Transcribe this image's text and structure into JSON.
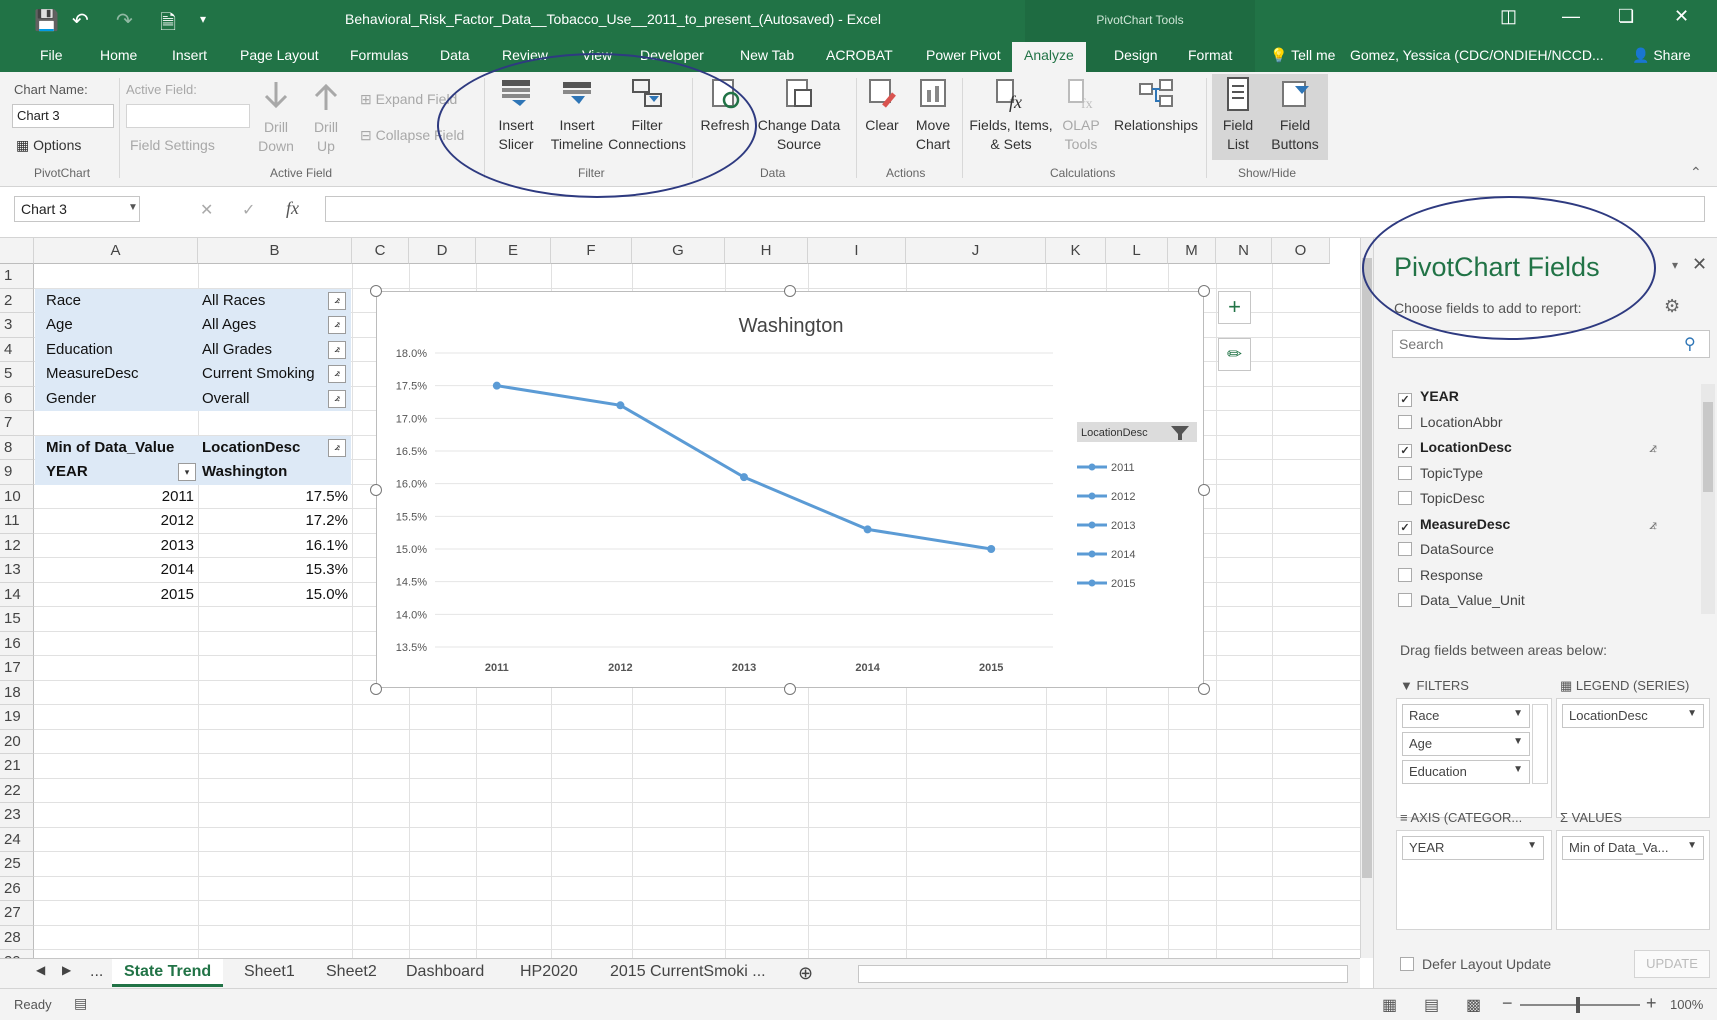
{
  "window": {
    "title": "Behavioral_Risk_Factor_Data__Tobacco_Use__2011_to_present_(Autosaved) - Excel",
    "context_header": "PivotChart Tools",
    "user": "Gomez, Yessica (CDC/ONDIEH/NCCD...",
    "share": "Share",
    "tell_me": "Tell me"
  },
  "tabs": [
    "File",
    "Home",
    "Insert",
    "Page Layout",
    "Formulas",
    "Data",
    "Review",
    "View",
    "Developer",
    "New Tab",
    "ACROBAT",
    "Power Pivot",
    "Analyze",
    "Design",
    "Format"
  ],
  "active_tab": "Analyze",
  "ribbon": {
    "chart_name_label": "Chart Name:",
    "chart_name_value": "Chart 3",
    "options": "Options",
    "group_pivotchart": "PivotChart",
    "active_field_label": "Active Field:",
    "field_settings": "Field Settings",
    "drill_down": "Drill Down",
    "drill_up": "Drill Up",
    "expand_field": "Expand Field",
    "collapse_field": "Collapse Field",
    "group_active_field": "Active Field",
    "insert_slicer": "Insert Slicer",
    "insert_timeline": "Insert Timeline",
    "filter_connections": "Filter Connections",
    "group_filter": "Filter",
    "refresh": "Refresh",
    "change_data_source": "Change Data Source",
    "group_data": "Data",
    "clear": "Clear",
    "move_chart": "Move Chart",
    "group_actions": "Actions",
    "fields_items_sets": "Fields, Items, & Sets",
    "olap_tools": "OLAP Tools",
    "relationships": "Relationships",
    "group_calculations": "Calculations",
    "field_list": "Field List",
    "field_buttons": "Field Buttons",
    "group_showhide": "Show/Hide"
  },
  "formula_bar": {
    "name_box": "Chart 3",
    "fx": "fx",
    "formula": ""
  },
  "columns": [
    "A",
    "B",
    "C",
    "D",
    "E",
    "F",
    "G",
    "H",
    "I",
    "J",
    "K",
    "L",
    "M",
    "N",
    "O"
  ],
  "rows": [
    "1",
    "2",
    "3",
    "4",
    "5",
    "6",
    "7",
    "8",
    "9",
    "10",
    "11",
    "12",
    "13",
    "14",
    "15",
    "16",
    "17",
    "18",
    "19",
    "20",
    "21",
    "22",
    "23",
    "24",
    "25",
    "26",
    "27",
    "28",
    "29"
  ],
  "filters": [
    {
      "field": "Race",
      "value": "All Races"
    },
    {
      "field": "Age",
      "value": "All Ages"
    },
    {
      "field": "Education",
      "value": "All Grades"
    },
    {
      "field": "MeasureDesc",
      "value": "Current Smoking"
    },
    {
      "field": "Gender",
      "value": "Overall"
    }
  ],
  "pivot": {
    "value_header": "Min of Data_Value",
    "column_field": "LocationDesc",
    "row_field": "YEAR",
    "column_item": "Washington",
    "rows": [
      {
        "year": "2011",
        "value": "17.5%"
      },
      {
        "year": "2012",
        "value": "17.2%"
      },
      {
        "year": "2013",
        "value": "16.1%"
      },
      {
        "year": "2014",
        "value": "15.3%"
      },
      {
        "year": "2015",
        "value": "15.0%"
      }
    ]
  },
  "chart_data": {
    "type": "line",
    "title": "Washington",
    "categories": [
      "2011",
      "2012",
      "2013",
      "2014",
      "2015"
    ],
    "series": [
      {
        "name": "",
        "values": [
          17.5,
          17.2,
          16.1,
          15.3,
          15.0
        ]
      }
    ],
    "ylim": [
      13.5,
      18.0
    ],
    "yticks": [
      "18.0%",
      "17.5%",
      "17.0%",
      "16.5%",
      "16.0%",
      "15.5%",
      "15.0%",
      "14.5%",
      "14.0%",
      "13.5%"
    ],
    "legend_title": "LocationDesc",
    "legend_entries": [
      "2011",
      "2012",
      "2013",
      "2014",
      "2015"
    ],
    "legend_position": "right",
    "color": "#5b9bd5",
    "grid": true
  },
  "pane": {
    "title": "PivotChart Fields",
    "subtitle": "Choose fields to add to report:",
    "search_placeholder": "Search",
    "fields": [
      {
        "name": "YEAR",
        "checked": true,
        "filtered": false
      },
      {
        "name": "LocationAbbr",
        "checked": false,
        "filtered": false
      },
      {
        "name": "LocationDesc",
        "checked": true,
        "filtered": true
      },
      {
        "name": "TopicType",
        "checked": false,
        "filtered": false
      },
      {
        "name": "TopicDesc",
        "checked": false,
        "filtered": false
      },
      {
        "name": "MeasureDesc",
        "checked": true,
        "filtered": true
      },
      {
        "name": "DataSource",
        "checked": false,
        "filtered": false
      },
      {
        "name": "Response",
        "checked": false,
        "filtered": false
      },
      {
        "name": "Data_Value_Unit",
        "checked": false,
        "filtered": false
      }
    ],
    "drag_hint": "Drag fields between areas below:",
    "filters_title": "FILTERS",
    "legend_title": "LEGEND (SERIES)",
    "axis_title": "AXIS (CATEGOR...",
    "values_title": "VALUES",
    "filters_items": [
      "Race",
      "Age",
      "Education"
    ],
    "legend_items": [
      "LocationDesc"
    ],
    "axis_items": [
      "YEAR"
    ],
    "values_items": [
      "Min of Data_Va..."
    ],
    "defer_label": "Defer Layout Update",
    "update": "UPDATE"
  },
  "sheets": [
    "State Trend",
    "Sheet1",
    "Sheet2",
    "Dashboard",
    "HP2020",
    "2015 CurrentSmoki ..."
  ],
  "active_sheet": "State Trend",
  "status": {
    "ready": "Ready",
    "zoom": "100%"
  }
}
